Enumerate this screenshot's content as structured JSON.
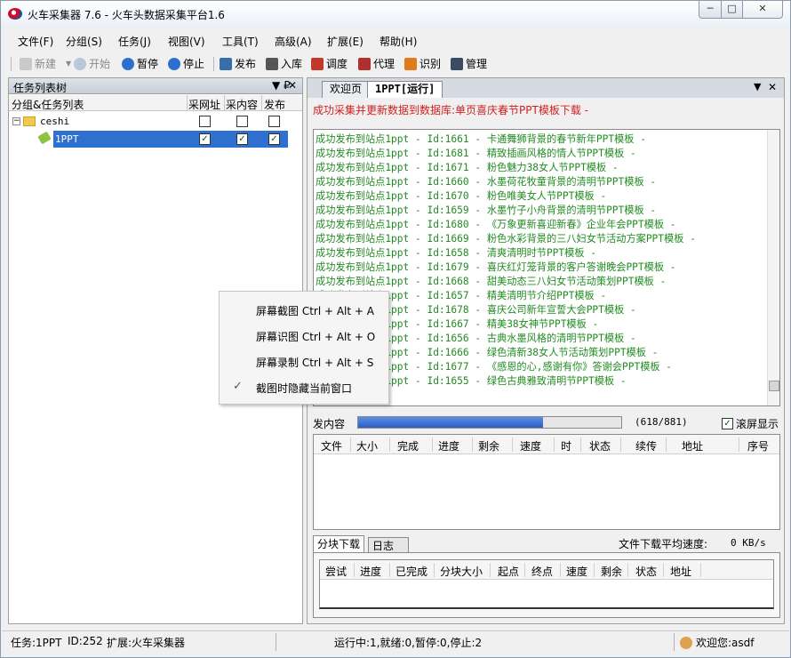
{
  "window": {
    "title": "火车采集器 7.6 - 火车头数据采集平台1.6",
    "min": "─",
    "max": "□",
    "close": "✕"
  },
  "menu": [
    "文件(F)",
    "分组(S)",
    "任务(J)",
    "视图(V)",
    "工具(T)",
    "高级(A)",
    "扩展(E)",
    "帮助(H)"
  ],
  "toolbar": {
    "new": "新建",
    "start": "开始",
    "pause": "暂停",
    "stop": "停止",
    "publish": "发布",
    "import": "入库",
    "schedule": "调度",
    "proxy": "代理",
    "recognize": "识别",
    "manage": "管理"
  },
  "task_panel": {
    "title": "任务列表树",
    "pin": "▼ ₽",
    "close": "✕",
    "col_name": "分组&任务列表",
    "col_url": "采网址",
    "col_content": "采内容",
    "col_publish": "发布",
    "group": {
      "name": "ceshi",
      "url": false,
      "content": false,
      "publish": false
    },
    "task": {
      "name": "1PPT",
      "url": true,
      "content": true,
      "publish": true
    }
  },
  "tabs": {
    "welcome": "欢迎页",
    "task": "1PPT[运行]"
  },
  "status_message": "成功采集并更新数据到数据库:单页喜庆春节PPT模板下载 -",
  "log": [
    "成功发布到站点1ppt - Id:1661 - 卡通舞狮背景的春节新年PPT模板 -",
    "成功发布到站点1ppt - Id:1681 - 精致插画风格的情人节PPT模板 -",
    "成功发布到站点1ppt - Id:1671 - 粉色魅力38女人节PPT模板 -",
    "成功发布到站点1ppt - Id:1660 - 水墨荷花牧童背景的清明节PPT模板 -",
    "成功发布到站点1ppt - Id:1670 - 粉色唯美女人节PPT模板 -",
    "成功发布到站点1ppt - Id:1659 - 水墨竹子小舟背景的清明节PPT模板 -",
    "成功发布到站点1ppt - Id:1680 - 《万象更新喜迎新春》企业年会PPT模板 -",
    "成功发布到站点1ppt - Id:1669 - 粉色水彩背景的三八妇女节活动方案PPT模板 -",
    "成功发布到站点1ppt - Id:1658 - 清爽清明时节PPT模板 -",
    "成功发布到站点1ppt - Id:1679 - 喜庆红灯笼背景的客户答谢晚会PPT模板 -",
    "成功发布到站点1ppt - Id:1668 - 甜美动态三八妇女节活动策划PPT模板 -",
    "成功发布到站点1ppt - Id:1657 - 精美清明节介绍PPT模板 -",
    "成功发布到站点1ppt - Id:1678 - 喜庆公司新年宣誓大会PPT模板 -",
    "成功发布到站点1ppt - Id:1667 - 精美38女神节PPT模板 -",
    "成功发布到站点1ppt - Id:1656 - 古典水墨风格的清明节PPT模板 -",
    "成功发布到站点1ppt - Id:1666 - 绿色清新38女人节活动策划PPT模板 -",
    "成功发布到站点1ppt - Id:1677 - 《感恩的心,感谢有你》答谢会PPT模板 -",
    "成功发布到站点1ppt - Id:1655 - 绿色古典雅致清明节PPT模板 -"
  ],
  "progress": {
    "label": "发内容",
    "done": 618,
    "total": 881,
    "count_text": "(618/881)",
    "auto_scroll_label": "滚屏显示",
    "auto_scroll": true
  },
  "download_columns": [
    "文件",
    "大小",
    "完成",
    "进度",
    "剩余",
    "速度",
    "时",
    "状态",
    "续传",
    "地址",
    "序号"
  ],
  "sub_tabs": {
    "block": "分块下载",
    "log": "日志"
  },
  "avg_speed_label": "文件下载平均速度:",
  "avg_speed_value": "0 KB/s",
  "block_columns": [
    "尝试",
    "进度",
    "已完成",
    "分块大小",
    "起点",
    "终点",
    "速度",
    "剩余",
    "状态",
    "地址"
  ],
  "statusbar": {
    "task": "任务:1PPT",
    "id": "ID:252",
    "ext": "扩展:火车采集器",
    "counts": "运行中:1,就绪:0,暂停:0,停止:2",
    "user": "欢迎您:asdf"
  },
  "context_menu": [
    "屏幕截图 Ctrl + Alt + A",
    "屏幕识图 Ctrl + Alt + O",
    "屏幕录制 Ctrl + Alt + S",
    "截图时隐藏当前窗口"
  ],
  "context_check": "✓",
  "colors": {
    "log_text": "#218b21",
    "status_red": "#d12020",
    "selection": "#2f6fd0",
    "progress": "#2a5fc4"
  }
}
